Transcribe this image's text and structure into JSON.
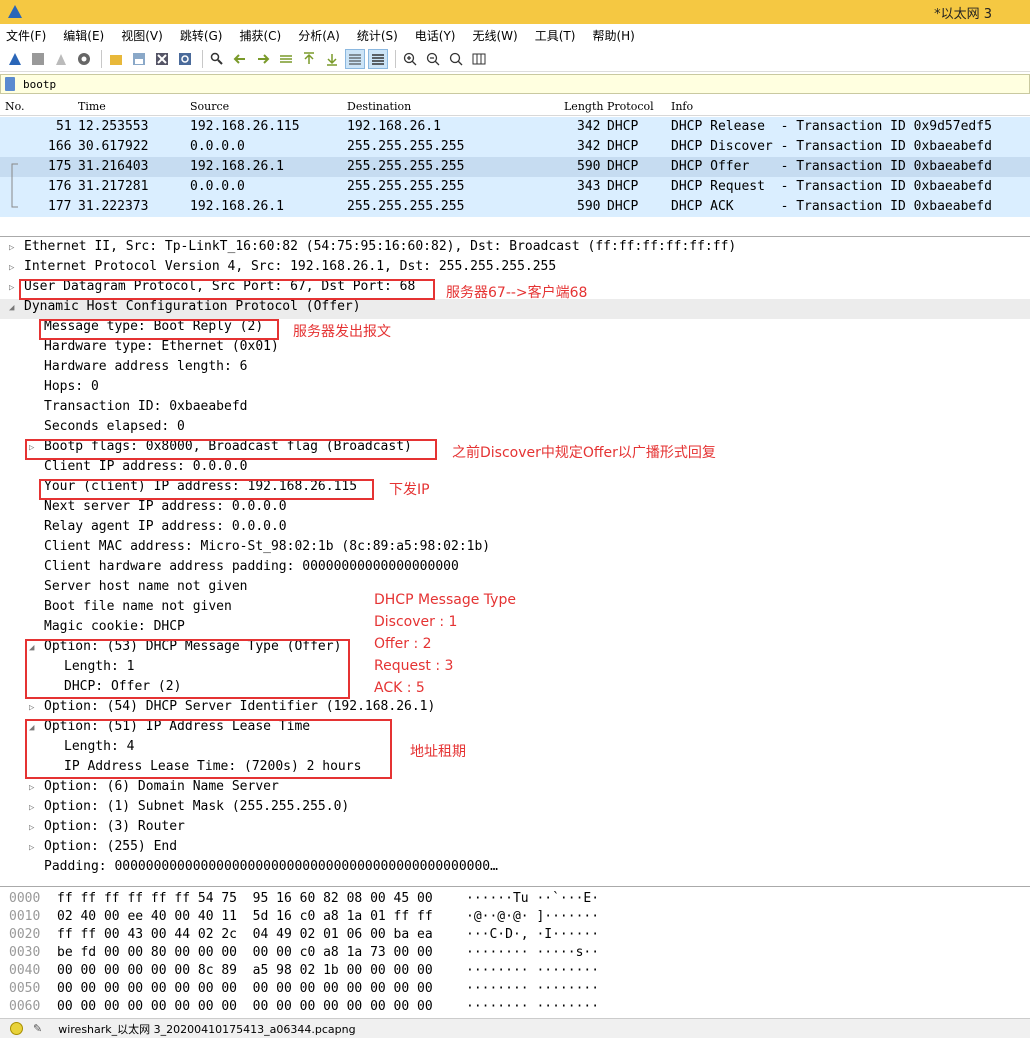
{
  "window": {
    "title": "*以太网 3"
  },
  "menu": [
    "文件(F)",
    "编辑(E)",
    "视图(V)",
    "跳转(G)",
    "捕获(C)",
    "分析(A)",
    "统计(S)",
    "电话(Y)",
    "无线(W)",
    "工具(T)",
    "帮助(H)"
  ],
  "toolbar": [
    "shark-fin-icon",
    "stop-icon",
    "restart-icon",
    "options-icon",
    "open-icon",
    "save-icon",
    "close-file-icon",
    "reload-icon",
    "find-icon",
    "back-icon",
    "forward-icon",
    "goto-packet-icon",
    "first-packet-icon",
    "last-packet-icon",
    "autoscroll-icon",
    "colorize-icon",
    "zoom-in-icon",
    "zoom-out-icon",
    "normal-size-icon",
    "resize-columns-icon"
  ],
  "filter": {
    "value": "bootp"
  },
  "packet_list": {
    "headers": {
      "no": "No.",
      "time": "Time",
      "source": "Source",
      "destination": "Destination",
      "length": "Length",
      "protocol": "Protocol",
      "info": "Info"
    },
    "rows": [
      {
        "no": "51",
        "time": "12.253553",
        "src": "192.168.26.115",
        "dst": "192.168.26.1",
        "len": "342",
        "proto": "DHCP",
        "info": "DHCP Release  - Transaction ID 0x9d57edf5"
      },
      {
        "no": "166",
        "time": "30.617922",
        "src": "0.0.0.0",
        "dst": "255.255.255.255",
        "len": "342",
        "proto": "DHCP",
        "info": "DHCP Discover - Transaction ID 0xbaeabefd"
      },
      {
        "no": "175",
        "time": "31.216403",
        "src": "192.168.26.1",
        "dst": "255.255.255.255",
        "len": "590",
        "proto": "DHCP",
        "info": "DHCP Offer    - Transaction ID 0xbaeabefd"
      },
      {
        "no": "176",
        "time": "31.217281",
        "src": "0.0.0.0",
        "dst": "255.255.255.255",
        "len": "343",
        "proto": "DHCP",
        "info": "DHCP Request  - Transaction ID 0xbaeabefd"
      },
      {
        "no": "177",
        "time": "31.222373",
        "src": "192.168.26.1",
        "dst": "255.255.255.255",
        "len": "590",
        "proto": "DHCP",
        "info": "DHCP ACK      - Transaction ID 0xbaeabefd"
      }
    ]
  },
  "details": {
    "top": [
      "Ethernet II, Src: Tp-LinkT_16:60:82 (54:75:95:16:60:82), Dst: Broadcast (ff:ff:ff:ff:ff:ff)",
      "Internet Protocol Version 4, Src: 192.168.26.1, Dst: 255.255.255.255",
      "User Datagram Protocol, Src Port: 67, Dst Port: 68",
      "Dynamic Host Configuration Protocol (Offer)"
    ],
    "fields": [
      "Message type: Boot Reply (2)",
      "Hardware type: Ethernet (0x01)",
      "Hardware address length: 6",
      "Hops: 0",
      "Transaction ID: 0xbaeabefd",
      "Seconds elapsed: 0",
      "Bootp flags: 0x8000, Broadcast flag (Broadcast)",
      "Client IP address: 0.0.0.0",
      "Your (client) IP address: 192.168.26.115",
      "Next server IP address: 0.0.0.0",
      "Relay agent IP address: 0.0.0.0",
      "Client MAC address: Micro-St_98:02:1b (8c:89:a5:98:02:1b)",
      "Client hardware address padding: 00000000000000000000",
      "Server host name not given",
      "Boot file name not given",
      "Magic cookie: DHCP",
      "Option: (53) DHCP Message Type (Offer)",
      "Length: 1",
      "DHCP: Offer (2)",
      "Option: (54) DHCP Server Identifier (192.168.26.1)",
      "Option: (51) IP Address Lease Time",
      "Length: 4",
      "IP Address Lease Time: (7200s) 2 hours",
      "Option: (6) Domain Name Server",
      "Option: (1) Subnet Mask (255.255.255.0)",
      "Option: (3) Router",
      "Option: (255) End",
      "Padding: 000000000000000000000000000000000000000000000000…"
    ]
  },
  "annotations": {
    "ports": "服务器67-->客户端68",
    "boot_reply": "服务器发出报文",
    "broadcast": "之前Discover中规定Offer以广播形式回复",
    "issue_ip": "下发IP",
    "msg_type": [
      "DHCP Message Type",
      "Discover : 1",
      "Offer : 2",
      "Request : 3",
      "ACK : 5"
    ],
    "lease": "地址租期",
    "color": "#e53333"
  },
  "hex": [
    {
      "off": "0000",
      "bytes": "ff ff ff ff ff ff 54 75  95 16 60 82 08 00 45 00",
      "ascii": "······Tu ··`···E·"
    },
    {
      "off": "0010",
      "bytes": "02 40 00 ee 40 00 40 11  5d 16 c0 a8 1a 01 ff ff",
      "ascii": "·@··@·@· ]·······"
    },
    {
      "off": "0020",
      "bytes": "ff ff 00 43 00 44 02 2c  04 49 02 01 06 00 ba ea",
      "ascii": "···C·D·, ·I······"
    },
    {
      "off": "0030",
      "bytes": "be fd 00 00 80 00 00 00  00 00 c0 a8 1a 73 00 00",
      "ascii": "········ ·····s··"
    },
    {
      "off": "0040",
      "bytes": "00 00 00 00 00 00 8c 89  a5 98 02 1b 00 00 00 00",
      "ascii": "········ ········"
    },
    {
      "off": "0050",
      "bytes": "00 00 00 00 00 00 00 00  00 00 00 00 00 00 00 00",
      "ascii": "········ ········"
    },
    {
      "off": "0060",
      "bytes": "00 00 00 00 00 00 00 00  00 00 00 00 00 00 00 00",
      "ascii": "········ ········"
    }
  ],
  "status": {
    "filename": "wireshark_以太网 3_20200410175413_a06344.pcapng"
  }
}
